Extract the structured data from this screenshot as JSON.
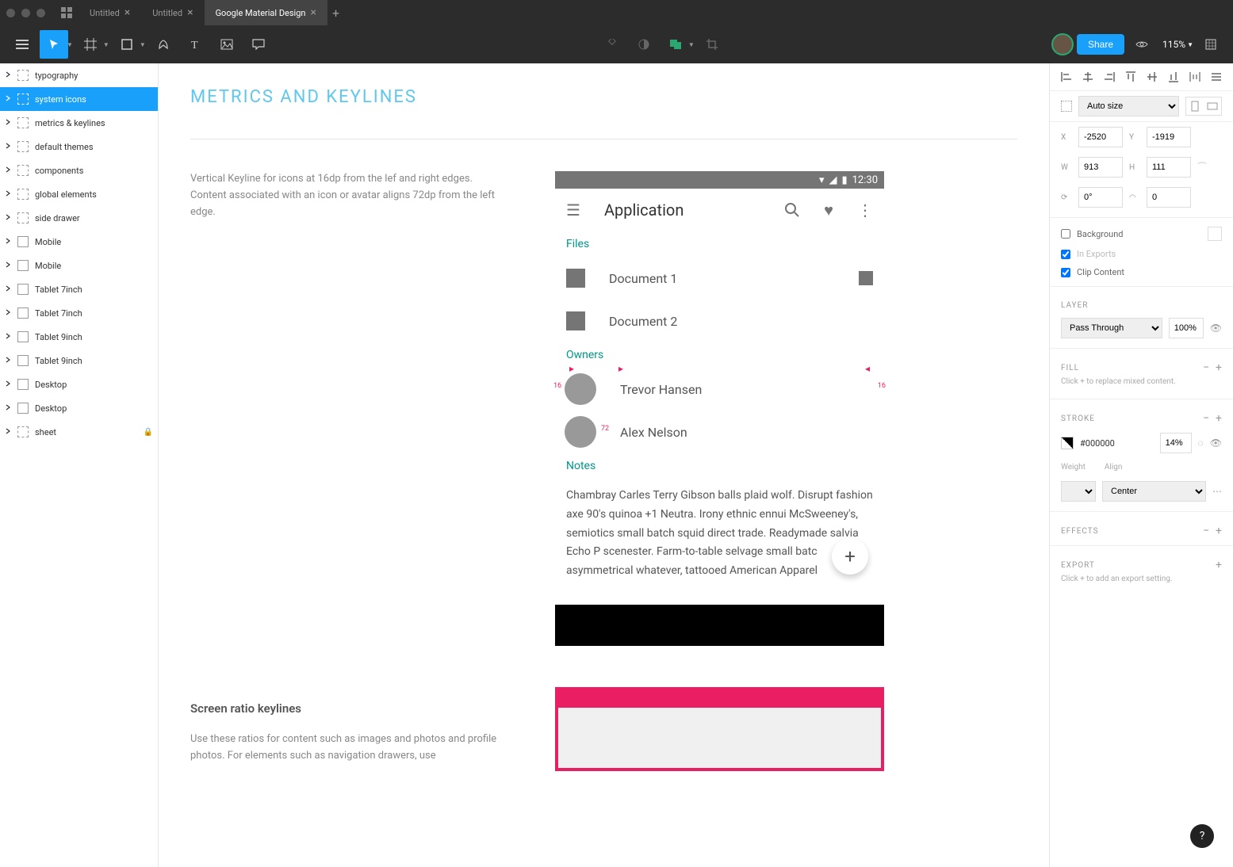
{
  "titlebar": {
    "tabs": [
      {
        "label": "Untitled",
        "active": false
      },
      {
        "label": "Untitled",
        "active": false
      },
      {
        "label": "Google Material Design",
        "active": true
      }
    ]
  },
  "toolbar": {
    "share_label": "Share",
    "zoom": "115%"
  },
  "layers": {
    "items": [
      {
        "label": "typography",
        "type": "slice"
      },
      {
        "label": "system icons",
        "type": "slice",
        "selected": true
      },
      {
        "label": "metrics & keylines",
        "type": "slice"
      },
      {
        "label": "default themes",
        "type": "slice"
      },
      {
        "label": "components",
        "type": "slice"
      },
      {
        "label": "global elements",
        "type": "slice"
      },
      {
        "label": "side drawer",
        "type": "slice"
      },
      {
        "label": "Mobile",
        "type": "frame"
      },
      {
        "label": "Mobile",
        "type": "frame"
      },
      {
        "label": "Tablet 7inch",
        "type": "frame"
      },
      {
        "label": "Tablet 7inch",
        "type": "frame"
      },
      {
        "label": "Tablet 9inch",
        "type": "frame"
      },
      {
        "label": "Tablet 9inch",
        "type": "frame"
      },
      {
        "label": "Desktop",
        "type": "frame"
      },
      {
        "label": "Desktop",
        "type": "frame"
      },
      {
        "label": "sheet",
        "type": "slice",
        "locked": true
      }
    ]
  },
  "canvas": {
    "section_title": "METRICS AND KEYLINES",
    "description": "Vertical Keyline for icons at 16dp from the lef and right edges. Content associated with an icon or avatar aligns 72dp from the left edge.",
    "sub_heading": "Screen ratio keylines",
    "sub_description": "Use these ratios for content such as images and photos and profile photos. For elements such as navigation drawers, use",
    "mockup": {
      "time": "12:30",
      "app_title": "Application",
      "sections": {
        "files": "Files",
        "owners": "Owners",
        "notes": "Notes"
      },
      "docs": [
        "Document 1",
        "Document 2"
      ],
      "owners": [
        "Trevor Hansen",
        "Alex Nelson"
      ],
      "notes_body": "Chambray Carles Terry Gibson balls plaid wolf. Disrupt fashion axe 90's quinoa +1 Neutra. Irony ethnic ennui McSweeney's, semiotics small batch squid direct trade. Readymade salvia Echo P scenester. Farm-to-table selvage small batc asymmetrical whatever, tattooed American Apparel",
      "measure_16_left": "16",
      "measure_16_right": "16",
      "measure_72": "72"
    }
  },
  "inspector": {
    "autosize": "Auto size",
    "x": "-2520",
    "y": "-1919",
    "w": "913",
    "h": "111",
    "rotation": "0°",
    "radius": "0",
    "background_label": "Background",
    "in_exports_label": "In Exports",
    "clip_content_label": "Clip Content",
    "layer_title": "LAYER",
    "blend_mode": "Pass Through",
    "opacity": "100%",
    "fill_title": "FILL",
    "fill_hint": "Click + to replace mixed content.",
    "stroke_title": "STROKE",
    "stroke_hex": "#000000",
    "stroke_opacity": "14%",
    "weight_label": "Weight",
    "align_label": "Align",
    "stroke_align": "Center",
    "effects_title": "EFFECTS",
    "export_title": "EXPORT",
    "export_hint": "Click + to add an export setting."
  },
  "help": "?"
}
